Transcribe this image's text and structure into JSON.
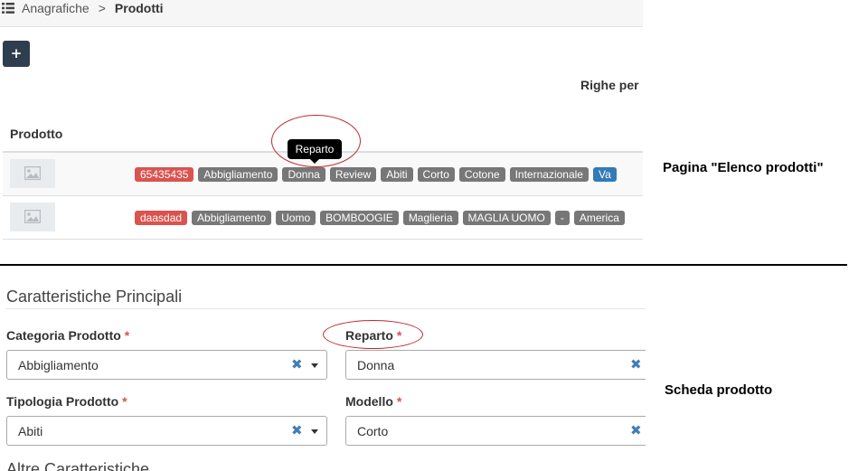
{
  "breadcrumb": {
    "parent": "Anagrafiche",
    "separator": ">",
    "current": "Prodotti"
  },
  "toolbar": {
    "add_label": "+",
    "rows_per_page_label": "Righe per"
  },
  "table": {
    "header": "Prodotto",
    "rows": [
      {
        "tags": [
          {
            "text": "65435435",
            "color": "red"
          },
          {
            "text": "Abbigliamento",
            "color": "gray"
          },
          {
            "text": "Donna",
            "color": "gray"
          },
          {
            "text": "Review",
            "color": "gray"
          },
          {
            "text": "Abiti",
            "color": "gray"
          },
          {
            "text": "Corto",
            "color": "gray"
          },
          {
            "text": "Cotone",
            "color": "gray"
          },
          {
            "text": "Internazionale",
            "color": "gray"
          },
          {
            "text": "Va",
            "color": "blue"
          }
        ]
      },
      {
        "tags": [
          {
            "text": "daasdad",
            "color": "red"
          },
          {
            "text": "Abbigliamento",
            "color": "gray"
          },
          {
            "text": "Uomo",
            "color": "gray"
          },
          {
            "text": "BOMBOOGIE",
            "color": "gray"
          },
          {
            "text": "Maglieria",
            "color": "gray"
          },
          {
            "text": "MAGLIA UOMO",
            "color": "gray"
          },
          {
            "text": "-",
            "color": "gray"
          },
          {
            "text": "America",
            "color": "gray"
          }
        ]
      }
    ]
  },
  "tooltip": {
    "text": "Reparto"
  },
  "annotations": {
    "list_page": "Pagina \"Elenco prodotti\"",
    "product_sheet": "Scheda prodotto"
  },
  "form": {
    "section_title": "Caratteristiche Principali",
    "next_section_title": "Altre Caratteristiche",
    "required_mark": "*",
    "clear_icon": "✖",
    "fields": {
      "categoria": {
        "label": "Categoria Prodotto",
        "value": "Abbigliamento"
      },
      "reparto": {
        "label": "Reparto",
        "value": "Donna"
      },
      "tipologia": {
        "label": "Tipologia Prodotto",
        "value": "Abiti"
      },
      "modello": {
        "label": "Modello",
        "value": "Corto"
      }
    }
  },
  "colors": {
    "tag_red": "#d9534f",
    "tag_gray": "#777777",
    "tag_blue": "#337ab7",
    "accent_blue": "#3f7fb8",
    "required_red": "#d9534f",
    "highlight_ellipse": "#c0272d"
  },
  "icons": {
    "breadcrumb": "list-icon",
    "thumbnail": "image-placeholder-icon",
    "clear": "clear-x-icon",
    "dropdown": "caret-down-icon"
  }
}
